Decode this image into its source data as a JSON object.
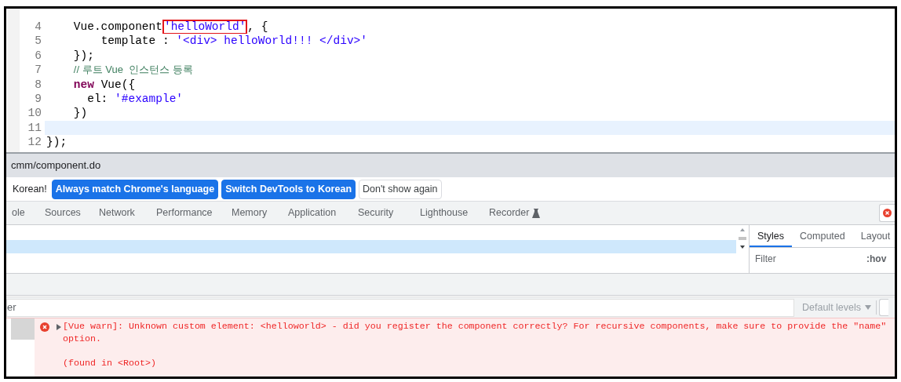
{
  "editor": {
    "lines": [
      {
        "number": "4",
        "current": false,
        "tokens": [
          {
            "kind": "code",
            "text": "    Vue.component"
          },
          {
            "kind": "string",
            "text": "'helloWorld'",
            "highlighted": true
          },
          {
            "kind": "code",
            "text": ", {"
          }
        ]
      },
      {
        "number": "5",
        "current": false,
        "tokens": [
          {
            "kind": "code",
            "text": "        template : "
          },
          {
            "kind": "string",
            "text": "'<div> helloWorld!!! </div>'"
          }
        ]
      },
      {
        "number": "6",
        "current": false,
        "tokens": [
          {
            "kind": "code",
            "text": "    });"
          }
        ]
      },
      {
        "number": "7",
        "current": false,
        "tokens": [
          {
            "kind": "comment",
            "text": "    // 루트 Vue  인스턴스 등록"
          }
        ]
      },
      {
        "number": "8",
        "current": false,
        "tokens": [
          {
            "kind": "keyword",
            "text": "    new"
          },
          {
            "kind": "code",
            "text": " Vue({"
          }
        ]
      },
      {
        "number": "9",
        "current": false,
        "tokens": [
          {
            "kind": "code",
            "text": "      el: "
          },
          {
            "kind": "string",
            "text": "'#example'"
          }
        ]
      },
      {
        "number": "10",
        "current": false,
        "tokens": [
          {
            "kind": "code",
            "text": "    })"
          }
        ]
      },
      {
        "number": "11",
        "current": true
      },
      {
        "number": "12",
        "current": false,
        "tokens": [
          {
            "kind": "code",
            "text": "});"
          }
        ]
      }
    ]
  },
  "devtools": {
    "url": "cmm/component.do",
    "infobar": {
      "message": "Korean!",
      "buttons": [
        {
          "label": "Always match Chrome's language",
          "kind": "primary"
        },
        {
          "label": "Switch DevTools to Korean",
          "kind": "primary"
        },
        {
          "label": "Don't show again",
          "kind": "secondary"
        }
      ]
    },
    "tabs": [
      {
        "label": "ole",
        "selected": false
      },
      {
        "label": "Sources",
        "selected": false
      },
      {
        "label": "Network",
        "selected": false
      },
      {
        "label": "Performance",
        "selected": false
      },
      {
        "label": "Memory",
        "selected": false
      },
      {
        "label": "Application",
        "selected": false
      },
      {
        "label": "Security",
        "selected": false
      },
      {
        "label": "Lighthouse",
        "selected": false
      },
      {
        "label": "Recorder",
        "selected": false,
        "experimental": true
      }
    ],
    "styles_pane": {
      "tabs": [
        {
          "label": "Styles",
          "selected": true
        },
        {
          "label": "Computed",
          "selected": false
        },
        {
          "label": "Layout",
          "selected": false
        }
      ],
      "filter": {
        "placeholder": "Filter"
      },
      "hov": ":hov"
    },
    "console": {
      "filter_text": "er",
      "levels": "Default levels",
      "messages": [
        {
          "kind": "error",
          "text": "[Vue warn]: Unknown custom element: <helloworld> - did you register the component correctly? For recursive components, make sure to provide the \"name\" option.",
          "source": "(found in <Root>)"
        }
      ]
    }
  }
}
